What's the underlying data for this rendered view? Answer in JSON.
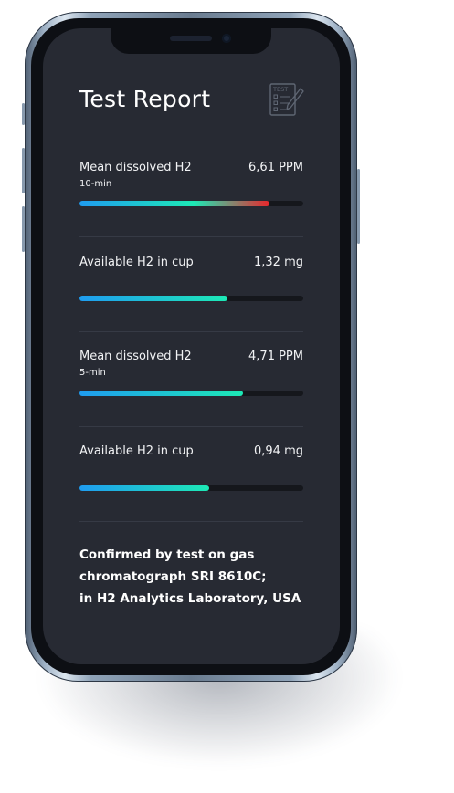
{
  "report": {
    "title": "Test Report",
    "icon_label": "TEST",
    "metrics": [
      {
        "label": "Mean dissolved H2",
        "sub": "10-min",
        "value": "6,61 PPM",
        "level": 0.85
      },
      {
        "label": "Available H2 in cup",
        "sub": "",
        "value": "1,32 mg",
        "level": 0.66
      },
      {
        "label": "Mean dissolved H2",
        "sub": "5-min",
        "value": "4,71 PPM",
        "level": 0.73
      },
      {
        "label": "Available H2 in cup",
        "sub": "",
        "value": "0,94 mg",
        "level": 0.58
      }
    ],
    "footer": [
      "Confirmed by test on gas",
      "chromatograph SRI 8610C;",
      "in H2 Analytics Laboratory, USA"
    ]
  },
  "colors": {
    "screen": "#272a33",
    "bar_start": "#1f9cf0",
    "bar_end": "#1de9b6",
    "bar_hot": "#e8262b",
    "track": "#15171c"
  }
}
